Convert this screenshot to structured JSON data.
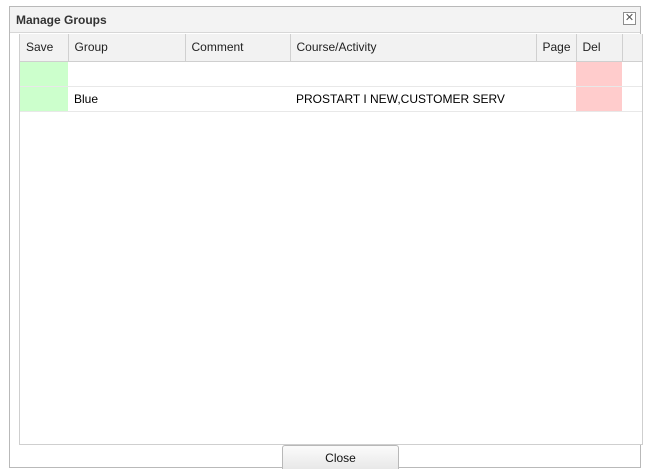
{
  "dialog": {
    "title": "Manage Groups",
    "close_icon": "close-x-icon"
  },
  "table": {
    "columns": [
      "Save",
      "Group",
      "Comment",
      "Course/Activity",
      "Page",
      "Del"
    ],
    "rows": [
      {
        "group": "",
        "comment": "",
        "course": "",
        "page": ""
      },
      {
        "group": "Blue",
        "comment": "",
        "course": "PROSTART I NEW,CUSTOMER SERV",
        "page": ""
      }
    ]
  },
  "colors": {
    "save_cell": "#ccffcc",
    "delete_cell": "#ffcccc"
  },
  "footer": {
    "close_label": "Close"
  }
}
